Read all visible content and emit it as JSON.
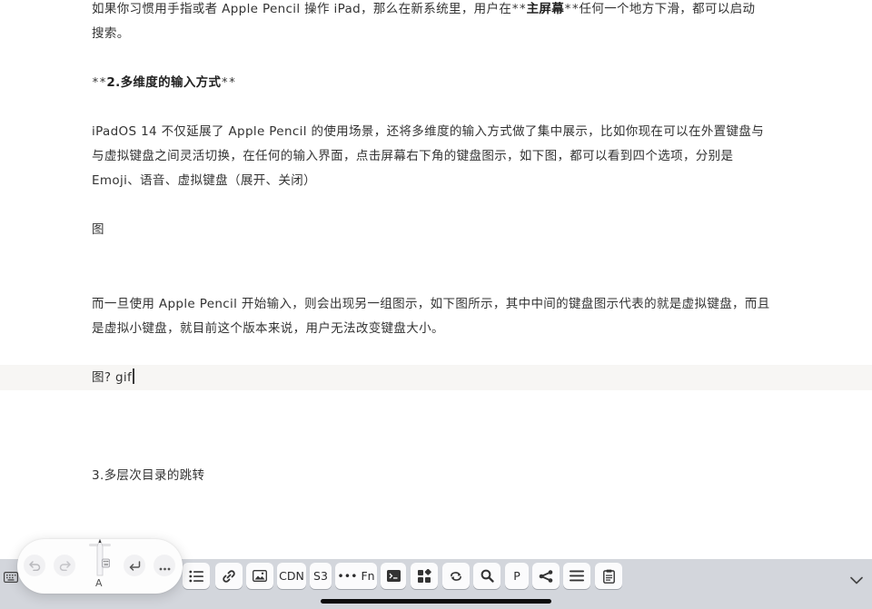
{
  "editor": {
    "lines": {
      "l1_pre": "如果你习惯用手指或者 Apple Pencil 操作 iPad，那么在新系统里，用户在",
      "l1_mark1": "**",
      "l1_bold": "主屏幕",
      "l1_mark2": "**",
      "l1_post": "任何一个地方下滑，都可以启动",
      "l2": "搜索。",
      "h_mark1": "**",
      "h_bold": "2.多维度的输入方式",
      "h_mark2": "**",
      "p1": "iPadOS 14 不仅延展了 Apple Pencil 的使用场景，还将多维度的输入方式做了集中展示，比如你现在可以在外置键盘与",
      "p2": "与虚拟键盘之间灵活切换，在任何的输入界面，点击屏幕右下角的键盘图示，如下图，都可以看到四个选项，分别是",
      "p3": "Emoji、语音、虚拟键盘（展开、关闭）",
      "fig1": "图",
      "q1": "而一旦使用 Apple Pencil 开始输入，则会出现另一组图示，如下图所示，其中中间的键盘图示代表的就是虚拟键盘，而且",
      "q2": "是虚拟小键盘，就目前这个版本来说，用户无法改变键盘大小。",
      "fig2": "图? gif",
      "sec3": "3.多层次目录的跳转"
    }
  },
  "toolbar": {
    "cdn_label": "CDN",
    "s3_label": "S3",
    "fn_label": "••• Fn",
    "p_label": "P"
  },
  "pencil_palette": {
    "label": "A"
  },
  "colors": {
    "toolbar_bg": "#d3d6dc",
    "key_bg": "#fbfbfc",
    "current_line": "#f7f6f4"
  }
}
